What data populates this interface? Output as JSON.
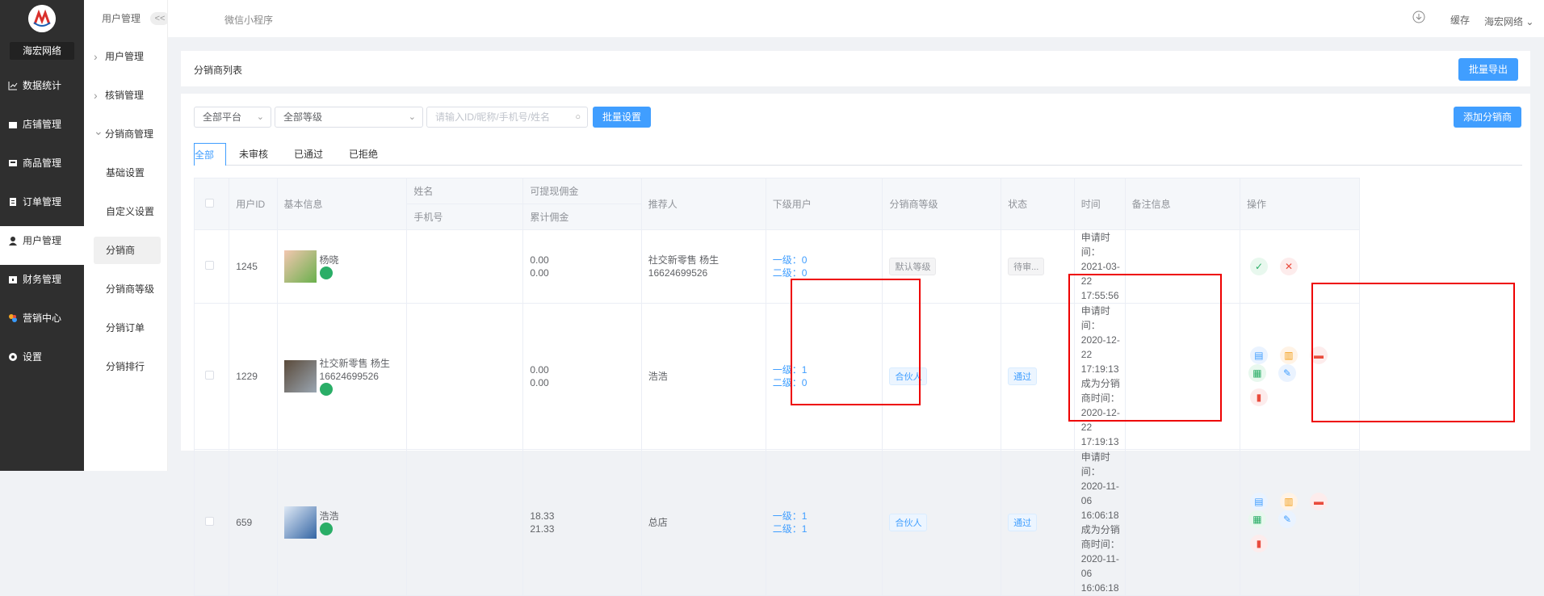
{
  "brand": {
    "name": "海宏网络"
  },
  "menu": [
    {
      "label": "数据统计",
      "icon": "chart-icon"
    },
    {
      "label": "店铺管理",
      "icon": "store-icon"
    },
    {
      "label": "商品管理",
      "icon": "goods-icon"
    },
    {
      "label": "订单管理",
      "icon": "order-icon"
    },
    {
      "label": "用户管理",
      "icon": "user-icon"
    },
    {
      "label": "财务管理",
      "icon": "finance-icon"
    },
    {
      "label": "营销中心",
      "icon": "marketing-icon"
    },
    {
      "label": "设置",
      "icon": "settings-icon"
    }
  ],
  "submenu": {
    "title": "用户管理",
    "collapse": "<<",
    "items": [
      "用户管理",
      "核销管理",
      "分销商管理",
      "基础设置",
      "自定义设置",
      "分销商",
      "分销商等级",
      "分销订单",
      "分销排行"
    ]
  },
  "topbar": {
    "tab": "微信小程序",
    "cache": "缓存",
    "user": "海宏网络"
  },
  "page": {
    "title": "分销商列表",
    "export": "批量导出",
    "add": "添加分销商",
    "batch": "批量设置"
  },
  "filters": {
    "platform": "全部平台",
    "level": "全部等级",
    "search_placeholder": "请输入ID/昵称/手机号/姓名"
  },
  "tabs": [
    "全部",
    "未审核",
    "已通过",
    "已拒绝"
  ],
  "table": {
    "headers": {
      "id": "用户ID",
      "info": "基本信息",
      "name": "姓名",
      "phone": "手机号",
      "withdrawable": "可提现佣金",
      "total": "累计佣金",
      "referrer": "推荐人",
      "sub": "下级用户",
      "level": "分销商等级",
      "status": "状态",
      "time": "时间",
      "remark": "备注信息",
      "ops": "操作"
    },
    "rows": [
      {
        "id": "1245",
        "nick": "杨晓",
        "w": "0.00",
        "t": "0.00",
        "ref": "社交新零售 杨生16624699526",
        "l1": "一级：0",
        "l2": "二级：0",
        "level": "默认等级",
        "status": "待审...",
        "t1": "申请时间：",
        "t1v": "2021-03-22 17:55:56",
        "t2": "",
        "t2v": ""
      },
      {
        "id": "1229",
        "nick": "社交新零售 杨生16624699526",
        "w": "0.00",
        "t": "0.00",
        "ref": "浩浩",
        "l1": "一级：1",
        "l2": "二级：0",
        "level": "合伙人",
        "status": "通过",
        "t1": "申请时间：",
        "t1v": "2020-12-22 17:19:13",
        "t2": "成为分销商时间：",
        "t2v": "2020-12-22 17:19:13"
      },
      {
        "id": "659",
        "nick": "浩浩",
        "w": "18.33",
        "t": "21.33",
        "ref": "总店",
        "l1": "一级：1",
        "l2": "二级：1",
        "level": "合伙人",
        "status": "通过",
        "t1": "申请时间：",
        "t1v": "2020-11-06 16:06:18",
        "t2": "成为分销商时间：",
        "t2v": "2020-11-06 16:06:18"
      }
    ]
  },
  "colors": {
    "primary": "#409eff",
    "highlight": "#e00000"
  }
}
